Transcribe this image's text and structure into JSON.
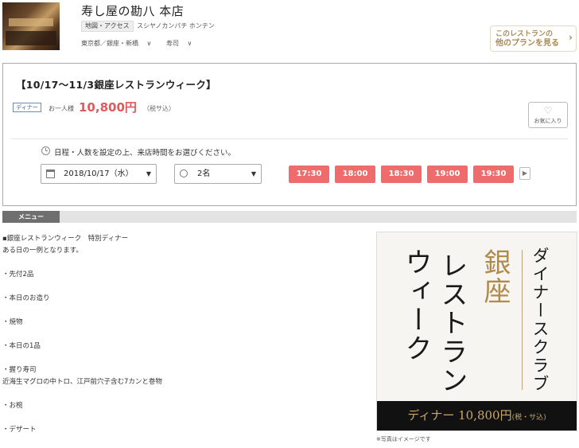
{
  "header": {
    "restaurant_name": "寿し屋の勘八 本店",
    "map_access": "地図・アクセス",
    "kana": "スシヤノカンパチ ホンテン",
    "area": "東京都／銀座・新橋",
    "genre": "寿司",
    "other_plans_line1": "このレストランの",
    "other_plans_line2": "他のプランを見る"
  },
  "plan": {
    "title": "【10/17〜11/3銀座レストランウィーク】",
    "badge": "ディナー",
    "per_person": "お一人様",
    "price": "10,800円",
    "tax": "（税サ込）",
    "favorite_label": "お気に入り",
    "instruction": "日程・人数を設定の上、来店時間をお選びください。",
    "date_value": "2018/10/17（水）",
    "people_value": "2名",
    "times": [
      "17:30",
      "18:00",
      "18:30",
      "19:00",
      "19:30"
    ],
    "accent_color": "#ef6c6c"
  },
  "menu": {
    "tab_label": "メニュー",
    "lines": [
      "▪銀座レストランウィーク　特別ディナー",
      "ある日の一例となります。",
      "",
      "・先付2品",
      "",
      "・本日のお造り",
      "",
      "・焼物",
      "",
      "・本日の1品",
      "",
      "・握り寿司",
      "近海生マグロの中トロ、江戸前穴子含む7カンと巻物",
      "",
      "・お椀",
      "",
      "・デザート"
    ]
  },
  "promo": {
    "subtitle": "ダイナースクラブ",
    "ginza": "銀座",
    "restaurant": "レストラン",
    "week": "ウィーク",
    "footer_main": "ディナー 10,800円",
    "footer_tax": "(税・サ込)",
    "caption": "※写真はイメージです"
  }
}
